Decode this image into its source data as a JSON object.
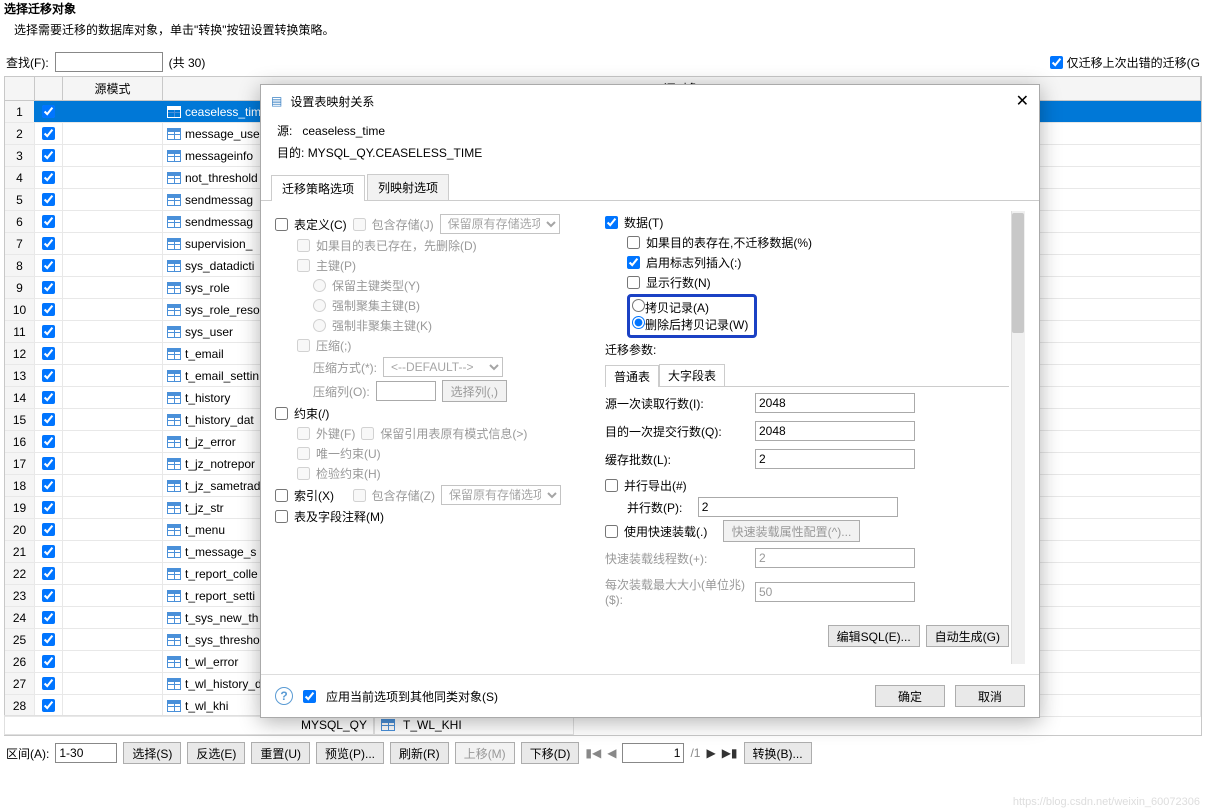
{
  "page": {
    "title": "选择迁移对象",
    "subtitle": "选择需要迁移的数据库对象，单击\"转换\"按钮设置转换策略。"
  },
  "topbar": {
    "find_label": "查找(F):",
    "find_value": "",
    "count": "(共 30)",
    "only_failed_label": "仅迁移上次出错的迁移(G"
  },
  "grid": {
    "header_mode": "源模式",
    "header_obj": "源对象",
    "rows": [
      {
        "n": "1",
        "obj": "ceaseless_time",
        "sel": true
      },
      {
        "n": "2",
        "obj": "message_use"
      },
      {
        "n": "3",
        "obj": "messageinfo"
      },
      {
        "n": "4",
        "obj": "not_threshold"
      },
      {
        "n": "5",
        "obj": "sendmessag"
      },
      {
        "n": "6",
        "obj": "sendmessag"
      },
      {
        "n": "7",
        "obj": "supervision_"
      },
      {
        "n": "8",
        "obj": "sys_datadicti"
      },
      {
        "n": "9",
        "obj": "sys_role"
      },
      {
        "n": "10",
        "obj": "sys_role_reso"
      },
      {
        "n": "11",
        "obj": "sys_user"
      },
      {
        "n": "12",
        "obj": "t_email"
      },
      {
        "n": "13",
        "obj": "t_email_settin"
      },
      {
        "n": "14",
        "obj": "t_history"
      },
      {
        "n": "15",
        "obj": "t_history_dat"
      },
      {
        "n": "16",
        "obj": "t_jz_error"
      },
      {
        "n": "17",
        "obj": "t_jz_notrepor"
      },
      {
        "n": "18",
        "obj": "t_jz_sametrad"
      },
      {
        "n": "19",
        "obj": "t_jz_str"
      },
      {
        "n": "20",
        "obj": "t_menu"
      },
      {
        "n": "21",
        "obj": "t_message_s"
      },
      {
        "n": "22",
        "obj": "t_report_colle"
      },
      {
        "n": "23",
        "obj": "t_report_setti"
      },
      {
        "n": "24",
        "obj": "t_sys_new_th"
      },
      {
        "n": "25",
        "obj": "t_sys_thresho"
      },
      {
        "n": "26",
        "obj": "t_wl_error"
      },
      {
        "n": "27",
        "obj": "t_wl_history_data"
      },
      {
        "n": "28",
        "obj": "t_wl_khi"
      }
    ]
  },
  "extra": {
    "mode": "MYSQL_QY",
    "obj": "T_WL_KHI"
  },
  "bottombar": {
    "range_label": "区间(A):",
    "range_value": "1-30",
    "btn_select": "选择(S)",
    "btn_invert": "反选(E)",
    "btn_reset": "重置(U)",
    "btn_preview": "预览(P)...",
    "btn_refresh": "刷新(R)",
    "btn_up": "上移(M)",
    "btn_down": "下移(D)",
    "page_current": "1",
    "page_total": "/1",
    "btn_convert": "转换(B)..."
  },
  "dialog": {
    "title": "设置表映射关系",
    "src_label": "源:",
    "src_value": "ceaseless_time",
    "dst_label": "目的:",
    "dst_value": "MYSQL_QY.CEASELESS_TIME",
    "tabs": {
      "strategy": "迁移策略选项",
      "column": "列映射选项"
    },
    "left": {
      "table_def": "表定义(C)",
      "include_store": "包含存储(J)",
      "keep_store_opt": "保留原有存储选项",
      "drop_if_exists": "如果目的表已存在，先删除(D)",
      "pk": "主键(P)",
      "pk_keep_type": "保留主键类型(Y)",
      "pk_force_cluster": "强制聚集主键(B)",
      "pk_force_noncluster": "强制非聚集主键(K)",
      "compress": "压缩(;)",
      "compress_method_label": "压缩方式(*):",
      "compress_method_value": "<--DEFAULT-->",
      "compress_col_label": "压缩列(O):",
      "btn_select_col": "选择列(,)",
      "constraint": "约束(/)",
      "fk": "外键(F)",
      "keep_ref_schema": "保留引用表原有模式信息(>)",
      "unique": "唯一约束(U)",
      "check": "检验约束(H)",
      "index": "索引(X)",
      "index_store": "包含存储(Z)",
      "keep_store_opt2": "保留原有存储选项",
      "comments": "表及字段注释(M)"
    },
    "right": {
      "data": "数据(T)",
      "skip_if_exists": "如果目的表存在,不迁移数据(%)",
      "identity_insert": "启用标志列插入(:)",
      "show_rows": "显示行数(N)",
      "copy_record": "拷贝记录(A)",
      "delete_then_copy": "删除后拷贝记录(W)",
      "params_label": "迁移参数:",
      "sub_tabs": {
        "normal": "普通表",
        "lob": "大字段表"
      },
      "src_batch_label": "源一次读取行数(I):",
      "src_batch_value": "2048",
      "dst_batch_label": "目的一次提交行数(Q):",
      "dst_batch_value": "2048",
      "cache_label": "缓存批数(L):",
      "cache_value": "2",
      "parallel_export": "并行导出(#)",
      "parallel_count_label": "并行数(P):",
      "parallel_count_value": "2",
      "fast_load": "使用快速装载(.)",
      "btn_fast_config": "快速装载属性配置(^)...",
      "fast_threads_label": "快速装载线程数(+):",
      "fast_threads_value": "2",
      "fast_max_label": "每次装载最大大小(单位兆)($):",
      "fast_max_value": "50",
      "btn_edit_sql": "编辑SQL(E)...",
      "btn_autogen": "自动生成(G)"
    },
    "footer": {
      "apply_to_same": "应用当前选项到其他同类对象(S)",
      "ok": "确定",
      "cancel": "取消"
    }
  },
  "watermark": "https://blog.csdn.net/weixin_60072306"
}
